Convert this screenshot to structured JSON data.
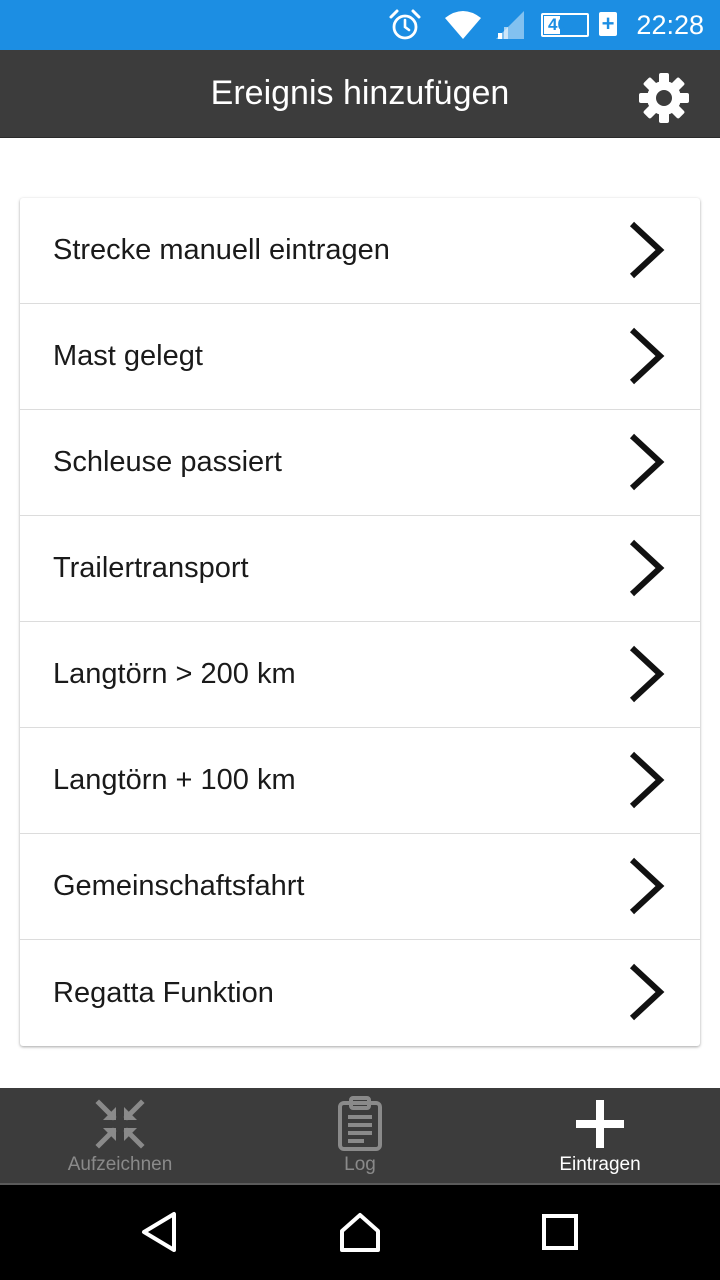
{
  "status_bar": {
    "time": "22:28",
    "battery": "40%",
    "battery_level": 0.4,
    "icons": [
      "alarm-icon",
      "wifi-icon",
      "cell-signal-icon",
      "battery-charging-icon"
    ],
    "background_color": "#1c8ee3"
  },
  "app_bar": {
    "title": "Ereignis hinzufügen",
    "settings_icon": "gear-icon",
    "background_color": "#3c3c3c"
  },
  "events": [
    {
      "label": "Strecke manuell eintragen",
      "icon": "chevron-right-icon"
    },
    {
      "label": "Mast gelegt",
      "icon": "chevron-right-icon"
    },
    {
      "label": "Schleuse passiert",
      "icon": "chevron-right-icon"
    },
    {
      "label": "Trailertransport",
      "icon": "chevron-right-icon"
    },
    {
      "label": "Langtörn > 200 km",
      "icon": "chevron-right-icon"
    },
    {
      "label": "Langtörn + 100 km",
      "icon": "chevron-right-icon"
    },
    {
      "label": "Gemeinschaftsfahrt",
      "icon": "chevron-right-icon"
    },
    {
      "label": "Regatta Funktion",
      "icon": "chevron-right-icon"
    }
  ],
  "bottom_nav": {
    "items": [
      {
        "label": "Aufzeichnen",
        "icon": "compress-arrows-icon",
        "active": false
      },
      {
        "label": "Log",
        "icon": "clipboard-icon",
        "active": false
      },
      {
        "label": "Eintragen",
        "icon": "plus-icon",
        "active": true
      }
    ],
    "active_color": "#ffffff",
    "inactive_color": "#8a8a8a"
  },
  "system_nav": {
    "buttons": [
      "back-triangle-icon",
      "home-icon",
      "recents-square-icon"
    ]
  }
}
